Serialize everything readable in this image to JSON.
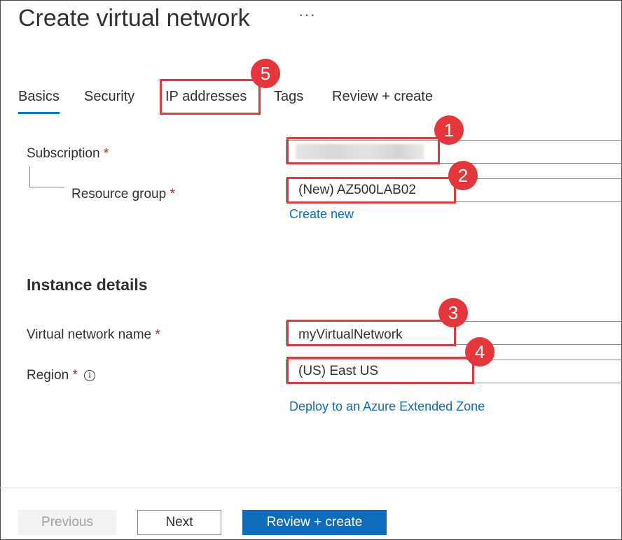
{
  "header": {
    "title": "Create virtual network",
    "more_label": "···"
  },
  "tabs": [
    {
      "label": "Basics"
    },
    {
      "label": "Security"
    },
    {
      "label": "IP addresses"
    },
    {
      "label": "Tags"
    },
    {
      "label": "Review + create"
    }
  ],
  "form": {
    "required_mark": "*",
    "subscription": {
      "label": "Subscription",
      "value": ""
    },
    "resource_group": {
      "label": "Resource group",
      "value": "(New) AZ500LAB02",
      "create_new": "Create new"
    },
    "instance_heading": "Instance details",
    "vnet_name": {
      "label": "Virtual network name",
      "value": "myVirtualNetwork"
    },
    "region": {
      "label": "Region",
      "value": "(US) East US",
      "info": "i",
      "extended_zone_link": "Deploy to an Azure Extended Zone"
    }
  },
  "annotations": [
    "1",
    "2",
    "3",
    "4",
    "5"
  ],
  "footer": {
    "previous": "Previous",
    "next": "Next",
    "review": "Review + create"
  },
  "colors": {
    "accent": "#0f6cbd",
    "annotation": "#e5363b",
    "required": "#a4262c"
  }
}
